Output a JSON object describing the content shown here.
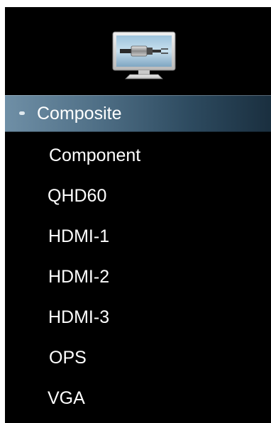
{
  "menu": {
    "icon": "monitor-connector-icon",
    "selected_index": 0,
    "colors": {
      "background": "#000000",
      "text": "#ffffff",
      "highlight": "#4f6f86"
    },
    "items": [
      {
        "label": "Composite"
      },
      {
        "label": "Component"
      },
      {
        "label": "QHD60"
      },
      {
        "label": "HDMI-1"
      },
      {
        "label": "HDMI-2"
      },
      {
        "label": "HDMI-3"
      },
      {
        "label": "OPS"
      },
      {
        "label": "VGA"
      }
    ]
  }
}
